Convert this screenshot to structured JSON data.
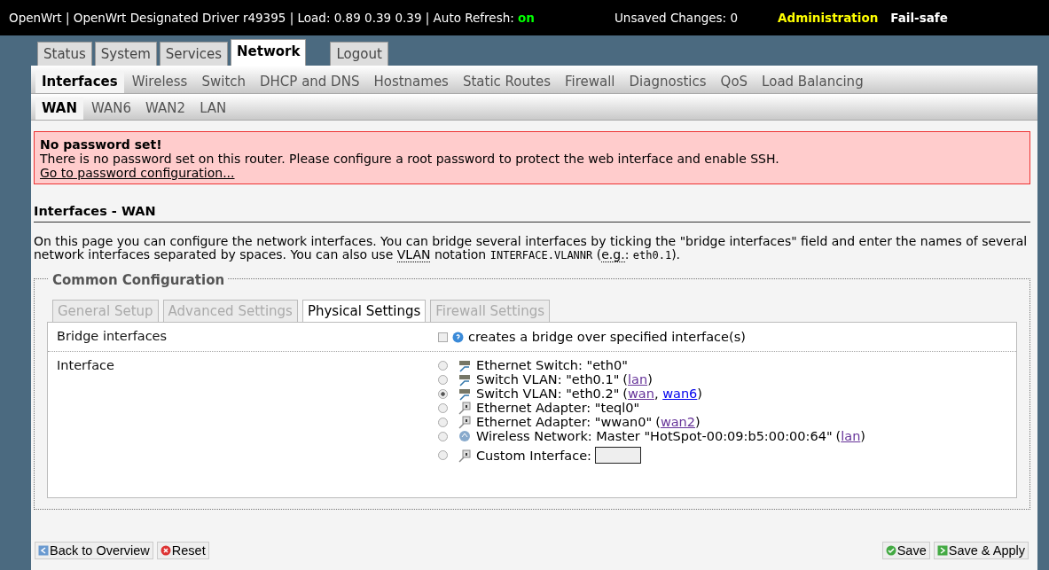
{
  "header": {
    "brand": "OpenWrt | OpenWrt Designated Driver r49395 | Load: 0.89 0.39 0.39 | Auto Refresh:",
    "auto_refresh": "on",
    "unsaved": "Unsaved Changes: 0",
    "modes": [
      {
        "label": "Administration",
        "selected": true
      },
      {
        "label": "Fail-safe",
        "selected": false
      }
    ]
  },
  "main_tabs": [
    {
      "label": "Status",
      "selected": false
    },
    {
      "label": "System",
      "selected": false
    },
    {
      "label": "Services",
      "selected": false
    },
    {
      "label": "Network",
      "selected": true
    },
    {
      "label": "Logout",
      "selected": false
    }
  ],
  "sub_tabs": [
    {
      "label": "Interfaces",
      "selected": true
    },
    {
      "label": "Wireless",
      "selected": false
    },
    {
      "label": "Switch",
      "selected": false
    },
    {
      "label": "DHCP and DNS",
      "selected": false
    },
    {
      "label": "Hostnames",
      "selected": false
    },
    {
      "label": "Static Routes",
      "selected": false
    },
    {
      "label": "Firewall",
      "selected": false
    },
    {
      "label": "Diagnostics",
      "selected": false
    },
    {
      "label": "QoS",
      "selected": false
    },
    {
      "label": "Load Balancing",
      "selected": false
    }
  ],
  "interface_tabs": [
    {
      "label": "WAN",
      "selected": true
    },
    {
      "label": "WAN6",
      "selected": false
    },
    {
      "label": "WAN2",
      "selected": false
    },
    {
      "label": "LAN",
      "selected": false
    }
  ],
  "alert": {
    "title": "No password set!",
    "message": "There is no password set on this router. Please configure a root password to protect the web interface and enable SSH.",
    "link": "Go to password configuration..."
  },
  "section_title": "Interfaces - WAN",
  "description": [
    {
      "kind": "text",
      "text": "On this page you can configure the network interfaces. You can bridge several interfaces by ticking the \"bridge interfaces\" field and enter the names of several network interfaces separated by spaces. You can also use "
    },
    {
      "kind": "abbr",
      "text": "VLAN"
    },
    {
      "kind": "text",
      "text": " notation "
    },
    {
      "kind": "code",
      "text": "INTERFACE.VLANNR"
    },
    {
      "kind": "text",
      "text": " ("
    },
    {
      "kind": "abbr",
      "text": "e.g."
    },
    {
      "kind": "text",
      "text": ": "
    },
    {
      "kind": "code",
      "text": "eth0.1"
    },
    {
      "kind": "text",
      "text": ")."
    }
  ],
  "fieldset": {
    "legend": "Common Configuration",
    "tabs": [
      {
        "label": "General Setup",
        "selected": false
      },
      {
        "label": "Advanced Settings",
        "selected": false
      },
      {
        "label": "Physical Settings",
        "selected": true
      },
      {
        "label": "Firewall Settings",
        "selected": false
      }
    ],
    "bridge": {
      "label": "Bridge interfaces",
      "checked": false,
      "hint": "creates a bridge over specified interface(s)"
    },
    "interface": {
      "label": "Interface",
      "options": [
        {
          "kind": "switch",
          "text": "Ethernet Switch: \"eth0\"",
          "selected": false
        },
        {
          "kind": "switch",
          "text": "Switch VLAN: \"eth0.1\"",
          "selected": false,
          "networks": {
            "open": "(",
            "items": [
              {
                "name": "lan",
                "visited": true
              }
            ],
            "close": ")"
          }
        },
        {
          "kind": "switch",
          "text": "Switch VLAN: \"eth0.2\"",
          "selected": true,
          "networks": {
            "open": "(",
            "items": [
              {
                "name": "wan",
                "visited": true
              },
              {
                "name": "wan6",
                "visited": false
              }
            ],
            "separator": ",",
            "close": ")"
          }
        },
        {
          "kind": "adapter",
          "text": "Ethernet Adapter: \"teql0\"",
          "selected": false
        },
        {
          "kind": "adapter",
          "text": "Ethernet Adapter: \"wwan0\"",
          "selected": false,
          "networks": {
            "open": "(",
            "items": [
              {
                "name": "wan2",
                "visited": true
              }
            ],
            "close": ")"
          }
        },
        {
          "kind": "wireless",
          "text": "Wireless Network: Master \"HotSpot-00:09:b5:00:00:64\"",
          "selected": false,
          "networks": {
            "open": "(",
            "items": [
              {
                "name": "lan",
                "visited": true
              }
            ],
            "close": ")"
          }
        },
        {
          "kind": "custom",
          "text": "Custom Interface:",
          "selected": false
        }
      ]
    }
  },
  "actions_left": [
    {
      "kind": "back",
      "label": "Back to Overview"
    },
    {
      "kind": "reset",
      "label": "Reset"
    }
  ],
  "actions_right": [
    {
      "kind": "save",
      "label": "Save"
    },
    {
      "kind": "apply",
      "label": "Save & Apply"
    }
  ]
}
